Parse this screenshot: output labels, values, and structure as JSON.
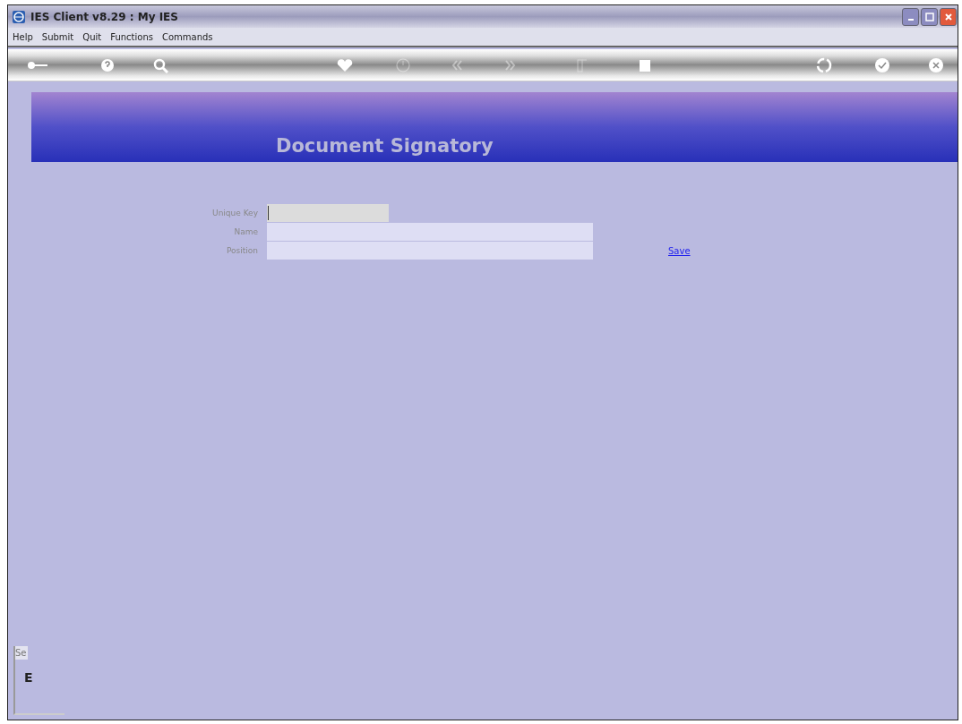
{
  "window": {
    "title": "IES Client v8.29 : My IES"
  },
  "menu": [
    "Help",
    "Submit",
    "Quit",
    "Functions",
    "Commands"
  ],
  "toolbar": [
    {
      "disabled": false
    },
    {
      "disabled": false
    },
    {
      "disabled": false
    },
    {
      "disabled": false
    },
    {
      "disabled": true
    },
    {
      "disabled": true
    },
    {
      "disabled": true
    },
    {
      "disabled": true
    },
    {
      "disabled": false
    },
    {
      "disabled": false
    },
    {
      "disabled": false
    },
    {
      "disabled": false
    }
  ],
  "banner": {
    "title": "Document Signatory"
  },
  "form": {
    "fields": [
      {
        "label": "Unique Key",
        "focused": true
      },
      {
        "label": "Name",
        "focused": false
      },
      {
        "label": "Position",
        "focused": false
      }
    ],
    "save_link": "Save"
  },
  "side_panel": {
    "tab": "Se",
    "letter": "E"
  }
}
